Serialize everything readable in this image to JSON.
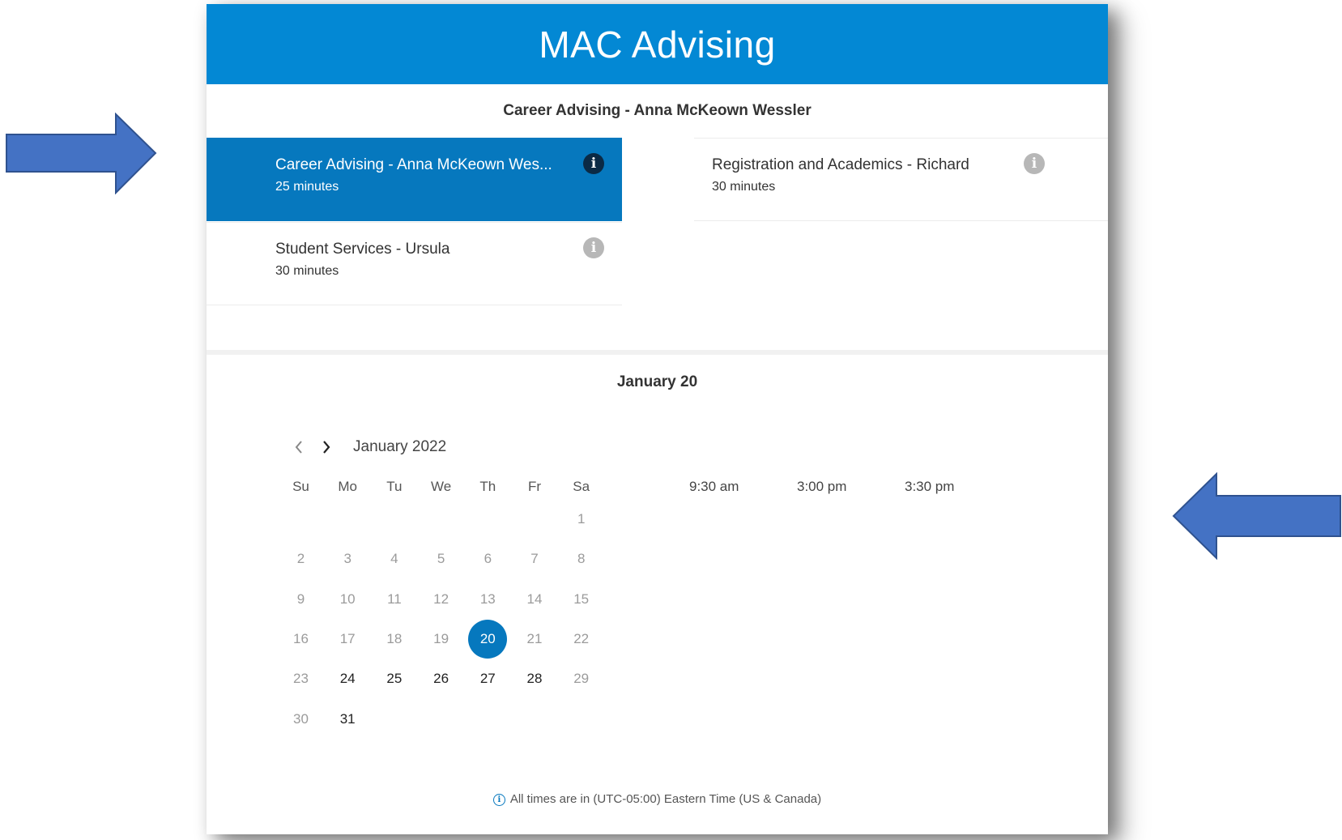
{
  "header": {
    "title": "MAC Advising"
  },
  "selected_service_heading": "Career Advising - Anna McKeown Wessler",
  "services": [
    {
      "name": "Career Advising - Anna McKeown Wes...",
      "duration": "25 minutes",
      "selected": true
    },
    {
      "name": "Student Services - Ursula",
      "duration": "30 minutes",
      "selected": false
    },
    {
      "name": "Registration and Academics - Richard",
      "duration": "30 minutes",
      "selected": false
    }
  ],
  "date_heading": "January 20",
  "calendar": {
    "month_label": "January 2022",
    "weekdays": [
      "Su",
      "Mo",
      "Tu",
      "We",
      "Th",
      "Fr",
      "Sa"
    ],
    "days": [
      "1",
      "2",
      "3",
      "4",
      "5",
      "6",
      "7",
      "8",
      "9",
      "10",
      "11",
      "12",
      "13",
      "14",
      "15",
      "16",
      "17",
      "18",
      "19",
      "20",
      "21",
      "22",
      "23",
      "24",
      "25",
      "26",
      "27",
      "28",
      "29",
      "30",
      "31"
    ],
    "selected_day": "20",
    "available_days": [
      "20",
      "24",
      "25",
      "26",
      "27",
      "28",
      "31"
    ]
  },
  "time_slots": [
    "9:30 am",
    "3:00 pm",
    "3:30 pm"
  ],
  "timezone_note": "All times are in (UTC-05:00) Eastern Time (US & Canada)",
  "colors": {
    "header_bg": "#0388d4",
    "selected_bg": "#0678be",
    "arrow": "#4472c4"
  },
  "icons": {
    "info": "info-icon",
    "prev": "chevron-left-icon",
    "next": "chevron-right-icon",
    "arrows": "block-arrow-icon"
  }
}
